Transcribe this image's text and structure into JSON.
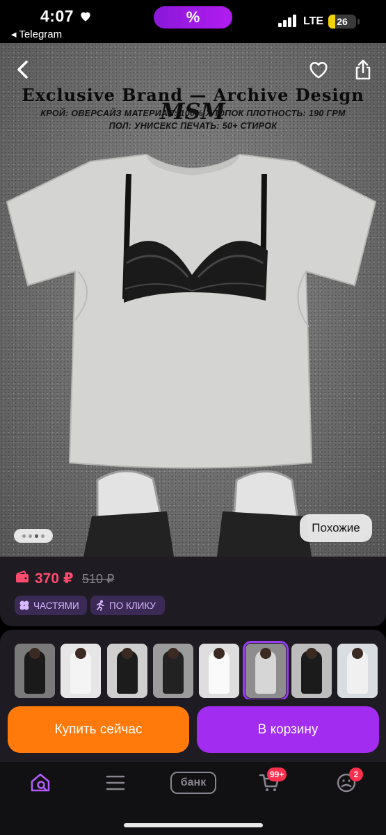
{
  "status_bar": {
    "time": "4:07",
    "back_app": "◂ Telegram",
    "center_pill": "%",
    "network": "LTE",
    "battery": "26",
    "battery_level": 0.26
  },
  "hero": {
    "brand_logo_text": "MSM",
    "brand_title": "Exclusive Brand — Archive Design",
    "spec_line1": "КРОЙ: ОВЕРСАЙЗ   МАТЕРИАЛ: 100% ХЛОПОК   ПЛОТНОСТЬ: 190 ГРМ",
    "spec_line2": "ПОЛ: УНИСЕКС   ПЕЧАТЬ: 50+ СТИРОК",
    "similar_button": "Похожие",
    "gallery_dots": 4,
    "gallery_active_dot": 2
  },
  "price": {
    "current": "370 ₽",
    "old": "510 ₽",
    "chips": [
      {
        "label": "ЧАСТЯМИ",
        "icon": "split-payment-icon"
      },
      {
        "label": "ПО КЛИКУ",
        "icon": "running-person-icon"
      }
    ]
  },
  "thumbnails": [
    {
      "name": "black-tee-print",
      "selected": false,
      "bg": "#7a7a7a",
      "fig": "#1a1a1a"
    },
    {
      "name": "white-tee-model",
      "selected": false,
      "bg": "#e6e6e6",
      "fig": "#f4f4f4"
    },
    {
      "name": "black-tee-back",
      "selected": false,
      "bg": "#cfcfcf",
      "fig": "#1c1c1c"
    },
    {
      "name": "black-tee-jeans",
      "selected": false,
      "bg": "#9c9c9c",
      "fig": "#222222"
    },
    {
      "name": "white-tee-script",
      "selected": false,
      "bg": "#dedede",
      "fig": "#fafafa"
    },
    {
      "name": "bra-print-tee",
      "selected": true,
      "bg": "#8d8d8d",
      "fig": "#d6d6d6"
    },
    {
      "name": "black-tee-bra",
      "selected": false,
      "bg": "#bdbdbd",
      "fig": "#1b1b1b"
    },
    {
      "name": "white-tee-hat",
      "selected": false,
      "bg": "#d8dde2",
      "fig": "#f0f0f0"
    }
  ],
  "actions": {
    "buy_now": "Купить сейчас",
    "add_to_cart": "В корзину"
  },
  "tabbar": {
    "bank_label": "банк",
    "cart_badge": "99+",
    "profile_badge": "2"
  },
  "colors": {
    "accent_purple": "#a22cf0",
    "buy_orange": "#ff7a0a",
    "price_red": "#ff4b6e",
    "panel_bg": "#1e1b22"
  }
}
